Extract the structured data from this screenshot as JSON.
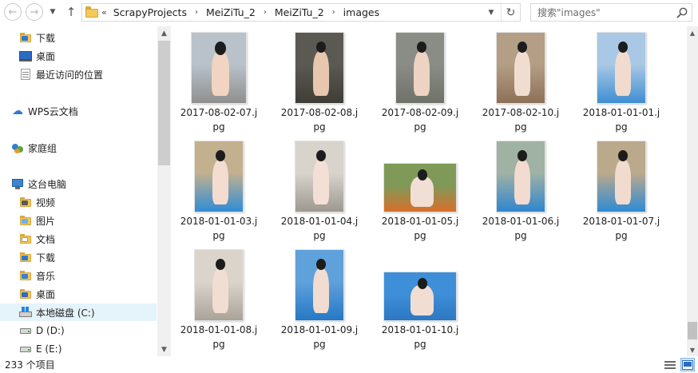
{
  "toolbar": {
    "back_icon": "arrow-left-icon",
    "forward_icon": "arrow-right-icon",
    "history_icon": "chevron-down-icon",
    "up_icon": "arrow-up-icon"
  },
  "address": {
    "overflow": "«",
    "crumbs": [
      "ScrapyProjects",
      "MeiZiTu_2",
      "MeiZiTu_2",
      "images"
    ],
    "separator": "›"
  },
  "search": {
    "placeholder": "搜索\"images\""
  },
  "sidebar": {
    "items": [
      {
        "label": "下载",
        "icon": "downloads-folder-icon"
      },
      {
        "label": "桌面",
        "icon": "desktop-icon"
      },
      {
        "label": "最近访问的位置",
        "icon": "recent-places-icon"
      },
      {
        "label": "WPS云文档",
        "icon": "cloud-icon"
      },
      {
        "label": "家庭组",
        "icon": "homegroup-icon"
      },
      {
        "label": "这台电脑",
        "icon": "this-pc-icon"
      },
      {
        "label": "视频",
        "icon": "videos-folder-icon"
      },
      {
        "label": "图片",
        "icon": "pictures-folder-icon"
      },
      {
        "label": "文档",
        "icon": "documents-folder-icon"
      },
      {
        "label": "下载",
        "icon": "downloads-folder-icon"
      },
      {
        "label": "音乐",
        "icon": "music-folder-icon"
      },
      {
        "label": "桌面",
        "icon": "desktop-folder-icon"
      },
      {
        "label": "本地磁盘 (C:)",
        "icon": "system-drive-icon"
      },
      {
        "label": "D (D:)",
        "icon": "drive-icon"
      },
      {
        "label": "E (E:)",
        "icon": "drive-icon"
      }
    ],
    "selected": "本地磁盘 (C:)"
  },
  "files": [
    {
      "name": "2017-08-02-07.jpg",
      "name_line1": "2017-08-02-07.j",
      "name_line2": "pg",
      "palette": [
        "#b9c2cb",
        "#8f8f8f",
        "#f2d4c2"
      ]
    },
    {
      "name": "2017-08-02-08.jpg",
      "name_line1": "2017-08-02-08.j",
      "name_line2": "pg",
      "palette": [
        "#5b5a52",
        "#3e3d36",
        "#e7c7b0"
      ]
    },
    {
      "name": "2017-08-02-09.jpg",
      "name_line1": "2017-08-02-09.j",
      "name_line2": "pg",
      "palette": [
        "#8a8d86",
        "#6f7268",
        "#ecd3c3"
      ]
    },
    {
      "name": "2017-08-02-10.jpg",
      "name_line1": "2017-08-02-10.j",
      "name_line2": "pg",
      "palette": [
        "#b49e86",
        "#8d7157",
        "#f1ddd0"
      ]
    },
    {
      "name": "2018-01-01-01.jpg",
      "name_line1": "2018-01-01-01.j",
      "name_line2": "pg",
      "palette": [
        "#a8c8e6",
        "#3f8ed1",
        "#f1dbcf"
      ]
    },
    {
      "name": "2018-01-01-03.jpg",
      "name_line1": "2018-01-01-03.j",
      "name_line2": "pg",
      "palette": [
        "#c2b08f",
        "#2f8dd6",
        "#f3dcd0"
      ]
    },
    {
      "name": "2018-01-01-04.jpg",
      "name_line1": "2018-01-01-04.j",
      "name_line2": "pg",
      "palette": [
        "#d8d3cb",
        "#9d9890",
        "#f3dfd5"
      ]
    },
    {
      "name": "2018-01-01-05.jpg",
      "name_line1": "2018-01-01-05.j",
      "name_line2": "pg",
      "palette": [
        "#7f9a58",
        "#d86f2c",
        "#f1ded5"
      ]
    },
    {
      "name": "2018-01-01-06.jpg",
      "name_line1": "2018-01-01-06.j",
      "name_line2": "pg",
      "palette": [
        "#9fb2a4",
        "#2f86cf",
        "#f2dbcf"
      ]
    },
    {
      "name": "2018-01-01-07.jpg",
      "name_line1": "2018-01-01-07.j",
      "name_line2": "pg",
      "palette": [
        "#bba98c",
        "#2d8bd4",
        "#f1dbce"
      ]
    },
    {
      "name": "2018-01-01-08.jpg",
      "name_line1": "2018-01-01-08.j",
      "name_line2": "pg",
      "palette": [
        "#dad4cb",
        "#a9a39a",
        "#f2ddd3"
      ]
    },
    {
      "name": "2018-01-01-09.jpg",
      "name_line1": "2018-01-01-09.j",
      "name_line2": "pg",
      "palette": [
        "#5fa1db",
        "#2678c6",
        "#f1dcd2"
      ]
    },
    {
      "name": "2018-01-01-10.jpg",
      "name_line1": "2018-01-01-10.j",
      "name_line2": "pg",
      "palette": [
        "#3f8fd8",
        "#2c77c2",
        "#f2ddd3"
      ]
    }
  ],
  "status": {
    "item_count": "233 个项目"
  },
  "view": {
    "details_icon": "details-view-icon",
    "tiles_icon": "large-icons-view-icon",
    "active": "large-icons"
  }
}
